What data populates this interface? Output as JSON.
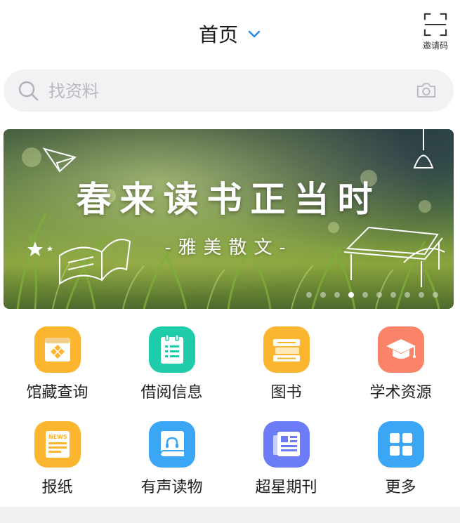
{
  "header": {
    "title": "首页",
    "invite_label": "邀请码"
  },
  "search": {
    "placeholder": "找资料"
  },
  "banner": {
    "title": "春来读书正当时",
    "subtitle": "-雅美散文-",
    "slide_count": 10,
    "active_slide": 3
  },
  "grid": {
    "items": [
      {
        "label": "馆藏查询",
        "icon": "library-collection-icon",
        "color": "#fbb52f"
      },
      {
        "label": "借阅信息",
        "icon": "borrow-info-icon",
        "color": "#1fcca9"
      },
      {
        "label": "图书",
        "icon": "books-icon",
        "color": "#fbb52f"
      },
      {
        "label": "学术资源",
        "icon": "graduation-cap-icon",
        "color": "#fb8367"
      },
      {
        "label": "报纸",
        "icon": "newspaper-icon",
        "color": "#fbb52f"
      },
      {
        "label": "有声读物",
        "icon": "audiobook-icon",
        "color": "#3ba5f6"
      },
      {
        "label": "超星期刊",
        "icon": "journal-icon",
        "color": "#6b7cf6"
      },
      {
        "label": "更多",
        "icon": "grid-more-icon",
        "color": "#3ba5f6"
      }
    ]
  },
  "colors": {
    "accent": "#2a8cf0",
    "search_bg": "#f2f2f5"
  }
}
